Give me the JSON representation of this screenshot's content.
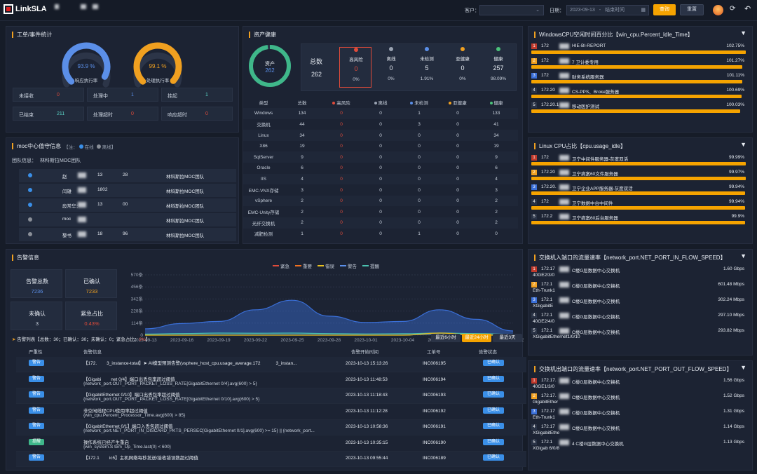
{
  "header": {
    "app_name": "LinkSLA",
    "customer_label": "客户：",
    "date_label": "日期：",
    "start_date": "2023-09-13",
    "end_placeholder": "结束时间",
    "query_btn": "查询",
    "reset_btn": "重置"
  },
  "ticket": {
    "title": "工单/事件统计",
    "gauge1": {
      "value": "93.9 %",
      "label": "响应执行率",
      "pct": 0.939,
      "color": "#5b8fe8"
    },
    "gauge2": {
      "value": "99.1 %",
      "label": "处理执行率",
      "pct": 0.991,
      "color": "#f0a020"
    },
    "cells": [
      {
        "label": "未接收",
        "value": "0",
        "color": "#e04b3a"
      },
      {
        "label": "处理中",
        "value": "1",
        "color": "#5b8fe8"
      },
      {
        "label": "挂起",
        "value": "1",
        "color": "#5bd6c8"
      },
      {
        "label": "已结束",
        "value": "211",
        "color": "#5bd6c8"
      },
      {
        "label": "处理超时",
        "value": "0",
        "color": "#e04b3a"
      },
      {
        "label": "响应超时",
        "value": "0",
        "color": "#e04b3a"
      }
    ]
  },
  "moc": {
    "title": "moc中心值守信息",
    "note": "【注：",
    "online": "在线",
    "offline": "离线",
    "note_end": "】",
    "team_label": "团队信息：",
    "team_name": "林科斯拉MOC团队",
    "rows": [
      {
        "name": "赵",
        "phone": "13",
        "tail": "28",
        "team": "林科斯拉MOC团队",
        "status": "online"
      },
      {
        "name": "闫雄",
        "phone": "1802",
        "tail": "",
        "team": "林科斯拉MOC团队",
        "status": "online"
      },
      {
        "name": "段常华：",
        "phone": "13",
        "tail": "00",
        "team": "林科斯拉MOC团队",
        "status": "online"
      },
      {
        "name": "moc",
        "phone": "",
        "tail": "",
        "team": "林科斯拉MOC团队",
        "status": "offline"
      },
      {
        "name": "黎书",
        "phone": "18",
        "tail": "96",
        "team": "林科斯拉MOC团队",
        "status": "offline"
      }
    ]
  },
  "asset": {
    "title": "资产健康",
    "donut_label": "资产",
    "donut_value": "262",
    "total_label": "总数",
    "total_value": "262",
    "summary": [
      {
        "label": "高风险",
        "value": "0",
        "pct": "0%",
        "color": "#e04b3a"
      },
      {
        "label": "离线",
        "value": "0",
        "pct": "0%",
        "color": "#9aa3b2"
      },
      {
        "label": "未检测",
        "value": "5",
        "pct": "1.91%",
        "color": "#5b8fe8"
      },
      {
        "label": "亚健康",
        "value": "0",
        "pct": "0%",
        "color": "#f0a020"
      },
      {
        "label": "健康",
        "value": "257",
        "pct": "98.09%",
        "color": "#4bc27a"
      }
    ],
    "columns": [
      "类型",
      "总数",
      "高风险",
      "离线",
      "未检测",
      "亚健康",
      "健康"
    ],
    "rows": [
      [
        "Windows",
        "134",
        "0",
        "0",
        "1",
        "0",
        "133"
      ],
      [
        "交换机",
        "44",
        "0",
        "0",
        "3",
        "0",
        "41"
      ],
      [
        "Linux",
        "34",
        "0",
        "0",
        "0",
        "0",
        "34"
      ],
      [
        "X86",
        "19",
        "0",
        "0",
        "0",
        "0",
        "19"
      ],
      [
        "SqlServer",
        "9",
        "0",
        "0",
        "0",
        "0",
        "9"
      ],
      [
        "Oracle",
        "6",
        "0",
        "0",
        "0",
        "0",
        "6"
      ],
      [
        "IIS",
        "4",
        "0",
        "0",
        "0",
        "0",
        "4"
      ],
      [
        "EMC-VNX存储",
        "3",
        "0",
        "0",
        "0",
        "0",
        "3"
      ],
      [
        "vSphere",
        "2",
        "0",
        "0",
        "0",
        "0",
        "2"
      ],
      [
        "EMC-Unity存储",
        "2",
        "0",
        "0",
        "0",
        "0",
        "2"
      ],
      [
        "光纤交换机",
        "2",
        "0",
        "0",
        "0",
        "0",
        "2"
      ],
      [
        "减肥检测",
        "1",
        "0",
        "0",
        "1",
        "0",
        "0"
      ]
    ]
  },
  "alarm": {
    "title": "告警信息",
    "boxes": [
      {
        "label": "告警总数",
        "value": "7236",
        "color": "#5b8fe8"
      },
      {
        "label": "已确认",
        "value": "7233",
        "color": "#f0a020"
      },
      {
        "label": "未确认",
        "value": "3",
        "color": "#c8d0dc"
      },
      {
        "label": "紧急占比",
        "value": "0.43%",
        "color": "#e04b3a"
      }
    ],
    "legend": [
      {
        "name": "紧急",
        "color": "#e04b3a"
      },
      {
        "name": "重要",
        "color": "#f07020"
      },
      {
        "name": "错误",
        "color": "#e8c020"
      },
      {
        "name": "警告",
        "color": "#5b8fe8"
      },
      {
        "name": "提醒",
        "color": "#4bc2b0"
      }
    ],
    "list_label": "告警列表【",
    "summary": "总数：30；已确认：30；未确认：0；紧急占比：",
    "summary_pct": "0%",
    "summary_end": "】",
    "tabs": [
      "最近6小时",
      "最近24小时",
      "最近3天"
    ],
    "columns": [
      "严重性",
      "告警信息",
      "告警开始时间",
      "工单号",
      "告警状态"
    ],
    "rows": [
      {
        "sev": "警告",
        "l1": "【172.",
        "l1b": "3_instance-total】➤ AI模型预测告警(vsphere_host_cpu.usage_average.172",
        "l1c": "3_instan...",
        "l2": "",
        "time": "2023-10-13 15:13:26",
        "no": "INC006195",
        "status": "已确认"
      },
      {
        "sev": "警告",
        "l1": "【Gigabi",
        "l1b": "net 0/4】端口出丢包率超过阈值",
        "l1c": "",
        "l2": "{network_port.OUT_PORT_PACKET_LOSS_RATE[GigabitEthernet 0/4].avg(600) > 5}",
        "time": "2023-10-13 11:48:53",
        "no": "INC006194",
        "status": "已确认"
      },
      {
        "sev": "警告",
        "l1": "【GigabitEthernet 0/10】端口出丢包率超过阈值",
        "l1b": "",
        "l1c": "",
        "l2": "{network_port.OUT_PORT_PACKET_LOSS_RATE[GigabitEthernet 0/10].avg(600) > 5}",
        "time": "2023-10-13 11:18:43",
        "no": "INC006193",
        "status": "已确认"
      },
      {
        "sev": "警告",
        "l1": "非空闲线程CPU使用率超过阈值",
        "l1b": "",
        "l1c": "",
        "l2": "{win_cpu.Percent_Processor_Time.avg(600) > 85}",
        "time": "2023-10-13 11:12:28",
        "no": "INC006192",
        "status": "已确认"
      },
      {
        "sev": "警告",
        "l1": "【GigabitEthernet 0/1】端口入丢包超过阈值",
        "l1b": "",
        "l1c": "",
        "l2": "{network_port.NET_PORT_IN_DISCARD_PKTS_PERSEC[GigabitEthernet 0/1].avg(600) >= 15} || {network_port...",
        "time": "2023-10-13 10:58:36",
        "no": "INC006191",
        "status": "已确认"
      },
      {
        "sev": "提醒",
        "l1": "操作系统已经产生重启",
        "l1b": "",
        "l1c": "",
        "l2": "{win_system.S    tem_Up_Time.last(0) < 600}",
        "time": "2023-10-13 10:35:15",
        "no": "INC006190",
        "status": "已确认"
      },
      {
        "sev": "警告",
        "l1": "【172.1",
        "l1b": "ic5】主机网络每秒发送/接收错误数超过阈值",
        "l1c": "",
        "l2": "",
        "time": "2023-10-13 09:55:44",
        "no": "INC006189",
        "status": "已确认"
      }
    ]
  },
  "chart_data": {
    "type": "area",
    "x": [
      "2023-09-13",
      "2023-09-16",
      "2023-09-19",
      "2023-09-22",
      "2023-09-25",
      "2023-09-28",
      "2023-10-01",
      "2023-10-04",
      "2023-10-07",
      "2023-10-10",
      "2023-10-13"
    ],
    "yticks": [
      "0",
      "114条",
      "228条",
      "342条",
      "456条",
      "570条"
    ],
    "ylim": [
      0,
      570
    ],
    "series": [
      {
        "name": "警告",
        "values": [
          60,
          110,
          130,
          240,
          330,
          180,
          120,
          130,
          240,
          150,
          40
        ]
      },
      {
        "name": "提醒",
        "values": [
          10,
          15,
          20,
          18,
          20,
          15,
          12,
          14,
          20,
          15,
          8
        ]
      },
      {
        "name": "紧急",
        "values": [
          0,
          0,
          0,
          0,
          0,
          0,
          0,
          0,
          20,
          0,
          0
        ]
      }
    ]
  },
  "rank1": {
    "title": "WindowsCPU空闲时间百分比【win_cpu.Percent_Idle_Time】",
    "rows": [
      {
        "rank": "1",
        "text": "172",
        "text2": "HIE-BI-REPORT",
        "value": "102.75%",
        "pct": 1.0,
        "color": "#c0392b"
      },
      {
        "rank": "2",
        "text": "172",
        "text2": "7 卫计委专用",
        "value": "101.27%",
        "pct": 0.985,
        "color": "#f0a020"
      },
      {
        "rank": "3",
        "text": "172",
        "text2": "财务系统服务器",
        "value": "101.11%",
        "pct": 0.984,
        "color": "#3a6fd8"
      },
      {
        "rank": "4",
        "text": "172.20",
        "text2": "CS-PPS、Broke服务器",
        "value": "100.69%",
        "pct": 0.98,
        "color": "#2a3346"
      },
      {
        "rank": "5",
        "text": "172.20.1",
        "text2": "移动医护测试",
        "value": "100.03%",
        "pct": 0.973,
        "color": "#2a3346"
      }
    ]
  },
  "rank2": {
    "title": "Linux  CPU占比【cpu.usage_idle】",
    "rows": [
      {
        "rank": "1",
        "text": "172",
        "text2": "卫宁中间件服务器-灰度双活",
        "value": "99.99%",
        "pct": 1.0,
        "color": "#c0392b"
      },
      {
        "rank": "2",
        "text": "172.20",
        "text2": "卫宁病案60文件服务器",
        "value": "99.97%",
        "pct": 0.999,
        "color": "#f0a020"
      },
      {
        "rank": "3",
        "text": "172.20.",
        "text2": "卫宁企业APP服务器-灰度双活",
        "value": "99.94%",
        "pct": 0.998,
        "color": "#3a6fd8"
      },
      {
        "rank": "4",
        "text": "172",
        "text2": "卫宁数据中台中间件",
        "value": "99.94%",
        "pct": 0.998,
        "color": "#2a3346"
      },
      {
        "rank": "5",
        "text": "172.2",
        "text2": "卫宁病案60后台服务器",
        "value": "99.9%",
        "pct": 0.997,
        "color": "#2a3346"
      }
    ]
  },
  "rank3": {
    "title": "交换机入端口的流量速率【network_port.NET_PORT_IN_FLOW_SPEED】",
    "rows": [
      {
        "rank": "1",
        "text": "172.17",
        "text2": "C楼G层数据中心交换机",
        "text3": "40GE2/3/0",
        "value": "1.60 Gbps",
        "color": "#c0392b"
      },
      {
        "rank": "2",
        "text": "172.1",
        "text2": "C楼G层数据中心交换机",
        "text3": "Eth-Trunk1",
        "value": "601.48 Mbps",
        "color": "#f0a020"
      },
      {
        "rank": "3",
        "text": "172.1",
        "text2": "C楼G层数据中心交换机",
        "text3": "XGigabitE",
        "value": "302.24 Mbps",
        "color": "#3a6fd8"
      },
      {
        "rank": "4",
        "text": "172.1",
        "text2": "C楼G层数据中心交换机",
        "text3": "40GE2/4/0",
        "value": "297.10 Mbps",
        "color": "#2a3346"
      },
      {
        "rank": "5",
        "text": "172.1",
        "text2": "C楼G层数据中心交换机",
        "text3": "XGigabitEthernet1/0/10",
        "value": "293.82 Mbps",
        "color": "#2a3346"
      }
    ]
  },
  "rank4": {
    "title": "交换机出端口的流量速率【network_port.NET_PORT_OUT_FLOW_SPEED】",
    "rows": [
      {
        "rank": "1",
        "text": "172.17.",
        "text2": "C楼G层数据中心交换机",
        "text3": "40GE1/3/0",
        "value": "1.56 Gbps",
        "color": "#c0392b"
      },
      {
        "rank": "2",
        "text": "172.17.",
        "text2": "C楼G层数据中心交换机",
        "text3": "GigabitEther",
        "value": "1.52 Gbps",
        "color": "#f0a020"
      },
      {
        "rank": "3",
        "text": "172.17",
        "text2": "C楼G层数据中心交换机",
        "text3": "Eth-Trunk1",
        "value": "1.31 Gbps",
        "color": "#3a6fd8"
      },
      {
        "rank": "4",
        "text": "172.17",
        "text2": "C楼G层数据中心交换机",
        "text3": "XGigabitEthe",
        "value": "1.14 Gbps",
        "color": "#2a3346"
      },
      {
        "rank": "5",
        "text": "172.1",
        "text2": "4 C楼G层数据中心交换机",
        "text3": "XGigab  6/0/8",
        "value": "1.13 Gbps",
        "color": "#2a3346"
      }
    ]
  }
}
